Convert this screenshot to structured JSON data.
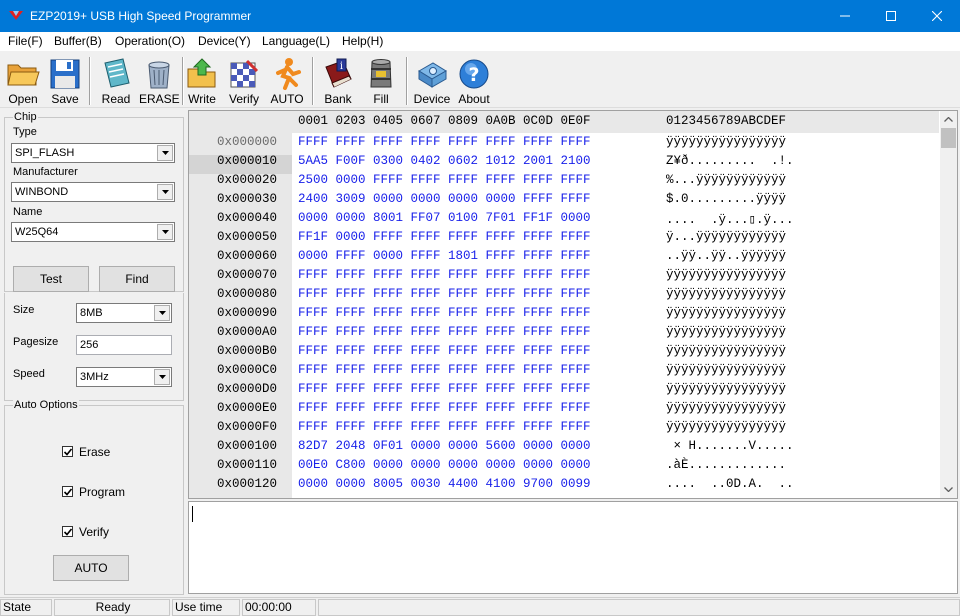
{
  "window": {
    "title": "EZP2019+ USB High Speed Programmer"
  },
  "menu": [
    {
      "name": "menu-file",
      "label": "File(F)"
    },
    {
      "name": "menu-buffer",
      "label": "Buffer(B)"
    },
    {
      "name": "menu-operation",
      "label": "Operation(O)"
    },
    {
      "name": "menu-device",
      "label": "Device(Y)"
    },
    {
      "name": "menu-language",
      "label": "Language(L)"
    },
    {
      "name": "menu-help",
      "label": "Help(H)"
    }
  ],
  "toolbar": [
    {
      "label": "Open",
      "icon": "folder-open-icon"
    },
    {
      "label": "Save",
      "icon": "floppy-disk-icon"
    },
    {
      "label": "Read",
      "icon": "read-chip-icon"
    },
    {
      "label": "ERASE",
      "icon": "erase-bin-icon"
    },
    {
      "label": "Write",
      "icon": "write-folder-icon"
    },
    {
      "label": "Verify",
      "icon": "verify-checker-icon"
    },
    {
      "label": "AUTO",
      "icon": "running-man-icon"
    },
    {
      "label": "Bank",
      "icon": "info-book-icon"
    },
    {
      "label": "Fill",
      "icon": "fill-barrel-icon"
    },
    {
      "label": "Device",
      "icon": "device-gear-icon"
    },
    {
      "label": "About",
      "icon": "question-icon"
    }
  ],
  "chip": {
    "group_label": "Chip",
    "type_label": "Type",
    "type_value": "SPI_FLASH",
    "manufacturer_label": "Manufacturer",
    "manufacturer_value": "WINBOND",
    "name_label": "Name",
    "name_value": "W25Q64",
    "test_button": "Test",
    "find_button": "Find"
  },
  "params": {
    "size_label": "Size",
    "size_value": "8MB",
    "pagesize_label": "Pagesize",
    "pagesize_value": "256",
    "speed_label": "Speed",
    "speed_value": "3MHz"
  },
  "auto_options": {
    "group_label": "Auto Options",
    "erase_label": "Erase",
    "erase_checked": true,
    "program_label": "Program",
    "program_checked": true,
    "verify_label": "Verify",
    "verify_checked": true,
    "auto_button": "AUTO"
  },
  "hex": {
    "header_offsets": "0001 0203 0405 0607 0809 0A0B 0C0D 0E0F",
    "header_ascii": "0123456789ABCDEF",
    "rows": [
      {
        "addr": "0x000000",
        "hex": "FFFF FFFF FFFF FFFF FFFF FFFF FFFF FFFF",
        "ascii": "ÿÿÿÿÿÿÿÿÿÿÿÿÿÿÿÿ"
      },
      {
        "addr": "0x000010",
        "hex": "5AA5 F00F 0300 0402 0602 1012 2001 2100",
        "ascii": "Z¥ð.........  .!."
      },
      {
        "addr": "0x000020",
        "hex": "2500 0000 FFFF FFFF FFFF FFFF FFFF FFFF",
        "ascii": "%...ÿÿÿÿÿÿÿÿÿÿÿÿ"
      },
      {
        "addr": "0x000030",
        "hex": "2400 3009 0000 0000 0000 0000 FFFF FFFF",
        "ascii": "$.0.........ÿÿÿÿ"
      },
      {
        "addr": "0x000040",
        "hex": "0000 0000 8001 FF07 0100 7F01 FF1F 0000",
        "ascii": "....  .ÿ...▯.ÿ..."
      },
      {
        "addr": "0x000050",
        "hex": "FF1F 0000 FFFF FFFF FFFF FFFF FFFF FFFF",
        "ascii": "ÿ...ÿÿÿÿÿÿÿÿÿÿÿÿ"
      },
      {
        "addr": "0x000060",
        "hex": "0000 FFFF 0000 FFFF 1801 FFFF FFFF FFFF",
        "ascii": "..ÿÿ..ÿÿ..ÿÿÿÿÿÿ"
      },
      {
        "addr": "0x000070",
        "hex": "FFFF FFFF FFFF FFFF FFFF FFFF FFFF FFFF",
        "ascii": "ÿÿÿÿÿÿÿÿÿÿÿÿÿÿÿÿ"
      },
      {
        "addr": "0x000080",
        "hex": "FFFF FFFF FFFF FFFF FFFF FFFF FFFF FFFF",
        "ascii": "ÿÿÿÿÿÿÿÿÿÿÿÿÿÿÿÿ"
      },
      {
        "addr": "0x000090",
        "hex": "FFFF FFFF FFFF FFFF FFFF FFFF FFFF FFFF",
        "ascii": "ÿÿÿÿÿÿÿÿÿÿÿÿÿÿÿÿ"
      },
      {
        "addr": "0x0000A0",
        "hex": "FFFF FFFF FFFF FFFF FFFF FFFF FFFF FFFF",
        "ascii": "ÿÿÿÿÿÿÿÿÿÿÿÿÿÿÿÿ"
      },
      {
        "addr": "0x0000B0",
        "hex": "FFFF FFFF FFFF FFFF FFFF FFFF FFFF FFFF",
        "ascii": "ÿÿÿÿÿÿÿÿÿÿÿÿÿÿÿÿ"
      },
      {
        "addr": "0x0000C0",
        "hex": "FFFF FFFF FFFF FFFF FFFF FFFF FFFF FFFF",
        "ascii": "ÿÿÿÿÿÿÿÿÿÿÿÿÿÿÿÿ"
      },
      {
        "addr": "0x0000D0",
        "hex": "FFFF FFFF FFFF FFFF FFFF FFFF FFFF FFFF",
        "ascii": "ÿÿÿÿÿÿÿÿÿÿÿÿÿÿÿÿ"
      },
      {
        "addr": "0x0000E0",
        "hex": "FFFF FFFF FFFF FFFF FFFF FFFF FFFF FFFF",
        "ascii": "ÿÿÿÿÿÿÿÿÿÿÿÿÿÿÿÿ"
      },
      {
        "addr": "0x0000F0",
        "hex": "FFFF FFFF FFFF FFFF FFFF FFFF FFFF FFFF",
        "ascii": "ÿÿÿÿÿÿÿÿÿÿÿÿÿÿÿÿ"
      },
      {
        "addr": "0x000100",
        "hex": "82D7 2048 0F01 0000 0000 5600 0000 0000",
        "ascii": " × H.......V....."
      },
      {
        "addr": "0x000110",
        "hex": "00E0 C800 0000 0000 0000 0000 0000 0000",
        "ascii": ".àÈ............."
      },
      {
        "addr": "0x000120",
        "hex": "0000 0000 8005 0030 4400 4100 9700 0099",
        "ascii": "....  ..0D.A.  .."
      }
    ]
  },
  "status": {
    "state_label": "State",
    "state_value": "Ready",
    "usetime_label": "Use time",
    "usetime_value": "00:00:00"
  },
  "colors": {
    "titlebar": "#0078d7",
    "hex_text": "#1a22ea"
  }
}
